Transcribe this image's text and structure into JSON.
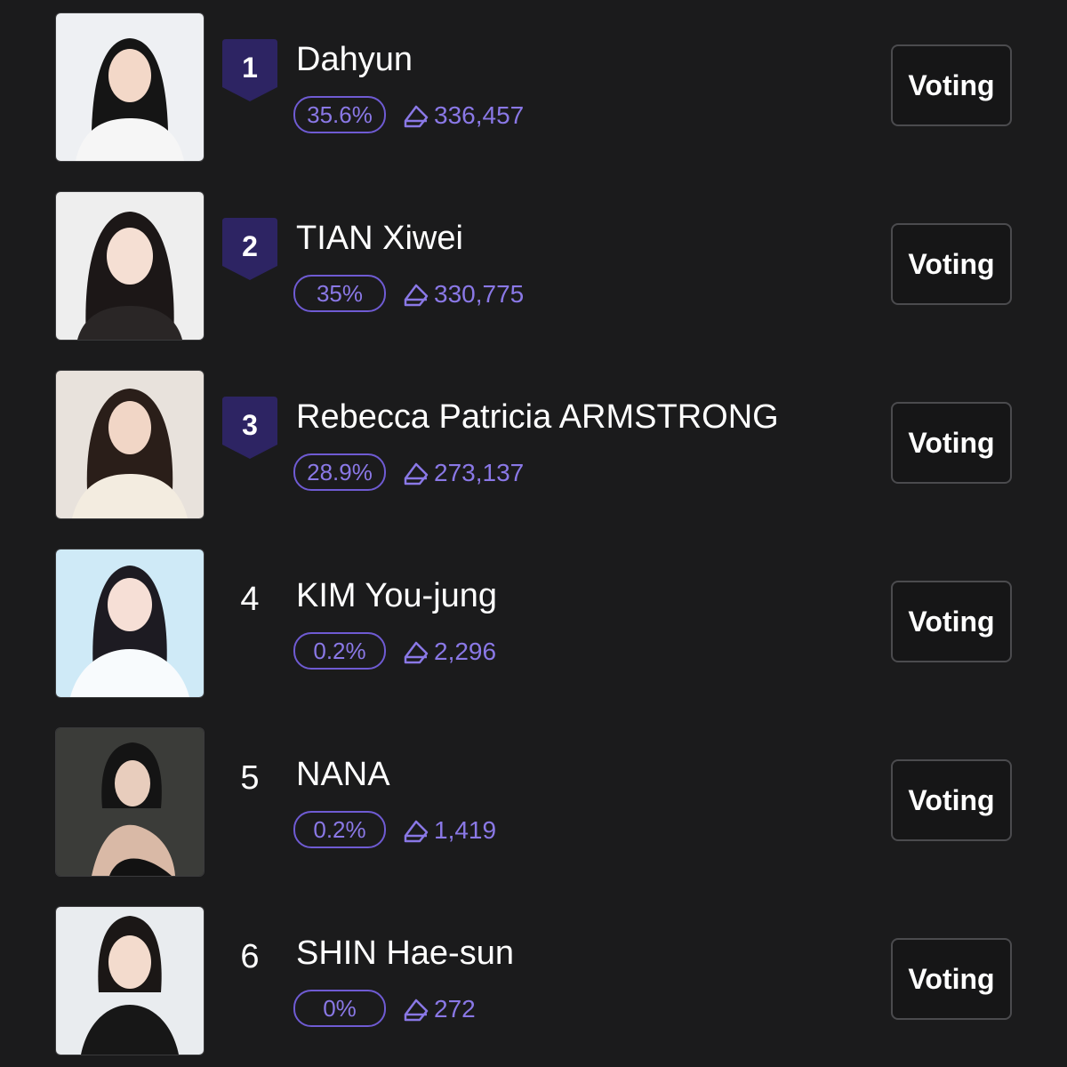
{
  "accent_color": "#6f5bd3",
  "badge_color": "#2d2463",
  "candidates": [
    {
      "rank": "1",
      "name": "Dahyun",
      "percent": "35.6%",
      "votes": "336,457",
      "button_label": "Voting",
      "badge": true,
      "photo_bg": "#eef0f3",
      "hair": "#151515",
      "shirt": "#f6f6f6"
    },
    {
      "rank": "2",
      "name": "TIAN Xiwei",
      "percent": "35%",
      "votes": "330,775",
      "button_label": "Voting",
      "badge": true,
      "photo_bg": "#eeeeee",
      "hair": "#1c1717",
      "shirt": "#2a2626"
    },
    {
      "rank": "3",
      "name": "Rebecca Patricia ARMSTRONG",
      "percent": "28.9%",
      "votes": "273,137",
      "button_label": "Voting",
      "badge": true,
      "photo_bg": "#e8e2dc",
      "hair": "#2a1e19",
      "shirt": "#f3ece0"
    },
    {
      "rank": "4",
      "name": "KIM You-jung",
      "percent": "0.2%",
      "votes": "2,296",
      "button_label": "Voting",
      "badge": false,
      "photo_bg": "#cfeaf7",
      "hair": "#1d1b22",
      "shirt": "#f8fbfd"
    },
    {
      "rank": "5",
      "name": "NANA",
      "percent": "0.2%",
      "votes": "1,419",
      "button_label": "Voting",
      "badge": false,
      "photo_bg": "#3b3c39",
      "hair": "#141414",
      "shirt": "#121212"
    },
    {
      "rank": "6",
      "name": "SHIN Hae-sun",
      "percent": "0%",
      "votes": "272",
      "button_label": "Voting",
      "badge": false,
      "photo_bg": "#e9ecef",
      "hair": "#1b1716",
      "shirt": "#171717"
    }
  ]
}
